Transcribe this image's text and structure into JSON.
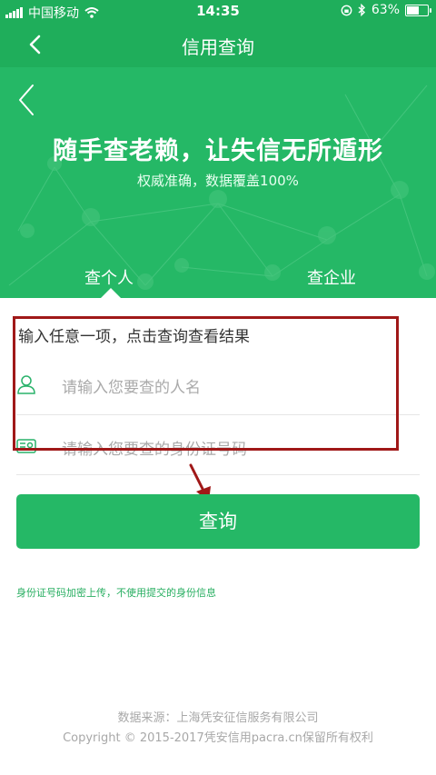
{
  "status_bar": {
    "carrier": "中国移动",
    "time": "14:35",
    "battery": "63%",
    "battery_level": 0.63,
    "icons": [
      "signal-icon",
      "wifi-icon",
      "orientation-lock-icon",
      "bluetooth-icon",
      "battery-icon"
    ]
  },
  "nav": {
    "title": "信用查询",
    "back_icon": "chevron-left-icon"
  },
  "banner": {
    "back_icon": "chevron-left-icon",
    "headline": "随手查老赖，让失信无所遁形",
    "subtitle": "权威准确，数据覆盖100%",
    "tabs": [
      {
        "label": "查个人",
        "active": true
      },
      {
        "label": "查企业",
        "active": false
      }
    ]
  },
  "form": {
    "instruction": "输入任意一项，点击查询查看结果",
    "fields": [
      {
        "icon": "person-icon",
        "placeholder": "请输入您要查的人名"
      },
      {
        "icon": "id-card-icon",
        "placeholder": "请输入您要查的身份证号码"
      }
    ],
    "submit_label": "查询",
    "notice": "身份证号码加密上传，不使用提交的身份信息"
  },
  "footer": {
    "line1": "数据来源：上海凭安征信服务有限公司",
    "line2": "Copyright © 2015-2017凭安信用pacra.cn保留所有权利"
  },
  "colors": {
    "brand_green": "#25b866",
    "status_green": "#1fae5b",
    "annotation_red": "#a01818"
  }
}
